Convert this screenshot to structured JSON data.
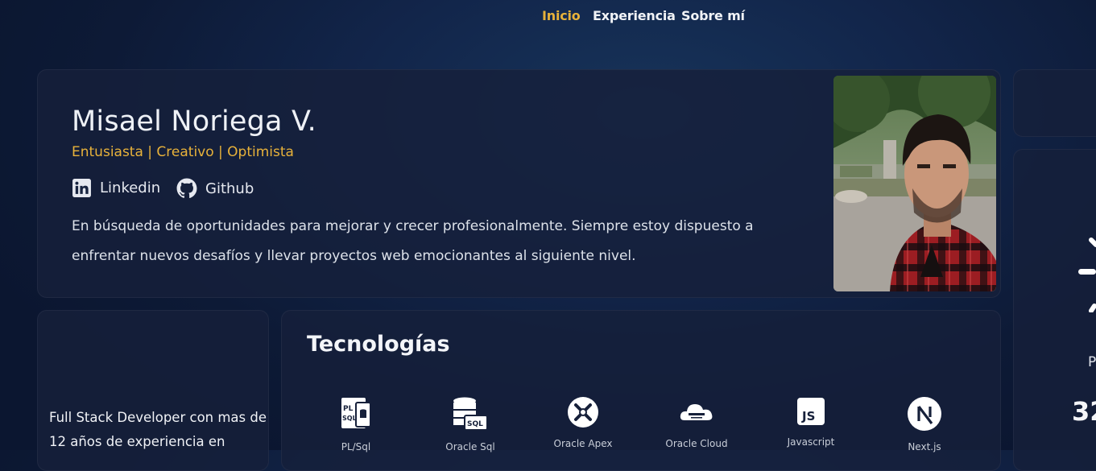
{
  "nav": {
    "items": [
      {
        "label": "Inicio",
        "active": true
      },
      {
        "label": "Experiencia",
        "active": false
      },
      {
        "label": "Sobre mí",
        "active": false
      }
    ]
  },
  "hero": {
    "name": "Misael Noriega V.",
    "tagline": "Entusiasta | Creativo | Optimista",
    "social": [
      {
        "label": "Linkedin",
        "icon": "linkedin-icon"
      },
      {
        "label": "Github",
        "icon": "github-icon"
      }
    ],
    "bio": "En búsqueda de oportunidades para mejorar y crecer profesionalmente. Siempre estoy dispuesto a enfrentar nuevos desafíos y llevar proyectos web emocionantes al siguiente nivel."
  },
  "summary": {
    "text": "Full Stack Developer con mas de 12 años de experiencia en"
  },
  "technologies": {
    "title": "Tecnologías",
    "items": [
      {
        "label": "PL/Sql",
        "icon": "plsql-icon"
      },
      {
        "label": "Oracle Sql",
        "icon": "oracle-sql-icon"
      },
      {
        "label": "Oracle Apex",
        "icon": "oracle-apex-icon"
      },
      {
        "label": "Oracle Cloud",
        "icon": "oracle-cloud-icon"
      },
      {
        "label": "Javascript",
        "icon": "javascript-icon"
      },
      {
        "label": "Next.js",
        "icon": "nextjs-icon"
      }
    ]
  },
  "right_panel": {
    "letter": "P",
    "number": "32"
  },
  "colors": {
    "accent": "#e8b23a",
    "background": "#0d1a36",
    "card": "#16203a"
  }
}
